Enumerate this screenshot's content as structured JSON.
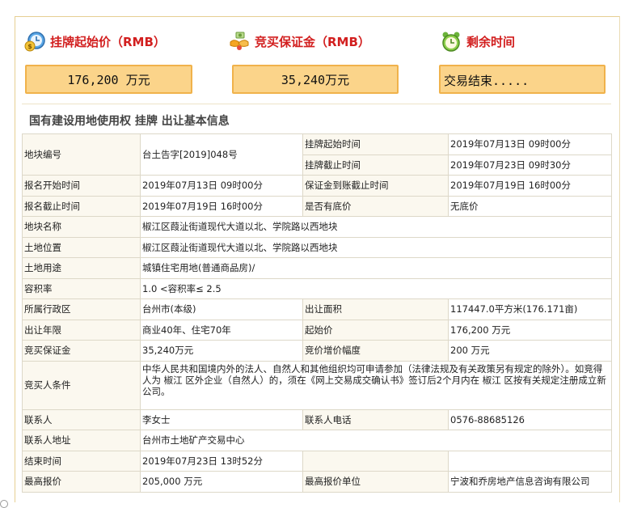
{
  "stats": {
    "start_price": {
      "label": "挂牌起始价（RMB）",
      "value": "176,200  万元",
      "icon": "money-clock-icon"
    },
    "deposit": {
      "label": "竞买保证金（RMB）",
      "value": "35,240万元",
      "icon": "hands-money-icon"
    },
    "remaining": {
      "label": "剩余时间",
      "value": "交易结束.....",
      "icon": "alarm-clock-icon"
    }
  },
  "section_title": "国有建设用地使用权 挂牌 出让基本信息",
  "table": {
    "r1": {
      "l1": "地块编号",
      "v1": "台土告字[2019]048号",
      "l2a": "挂牌起始时间",
      "v2a": "2019年07月13日 09时00分",
      "l2b": "挂牌截止时间",
      "v2b": "2019年07月23日 09时30分"
    },
    "r2": {
      "l1": "报名开始时间",
      "v1": "2019年07月13日 09时00分",
      "l2": "保证金到账截止时间",
      "v2": "2019年07月19日 16时00分"
    },
    "r3": {
      "l1": "报名截止时间",
      "v1": "2019年07月19日 16时00分",
      "l2": "是否有底价",
      "v2": "无底价"
    },
    "r4": {
      "l": "地块名称",
      "v": "椒江区葭沚街道现代大道以北、学院路以西地块"
    },
    "r5": {
      "l": "土地位置",
      "v": "椒江区葭沚街道现代大道以北、学院路以西地块"
    },
    "r6": {
      "l": "土地用途",
      "v": "城镇住宅用地(普通商品房)/"
    },
    "r7": {
      "l": "容积率",
      "v": "1.0 <容积率≤ 2.5"
    },
    "r8": {
      "l1": "所属行政区",
      "v1": "台州市(本级)",
      "l2": "出让面积",
      "v2": "117447.0平方米(176.171亩)"
    },
    "r9": {
      "l1": "出让年限",
      "v1": "商业40年、住宅70年",
      "l2": "起始价",
      "v2": "176,200 万元"
    },
    "r10": {
      "l1": "竞买保证金",
      "v1": "35,240万元",
      "l2": "竞价增价幅度",
      "v2": "200 万元"
    },
    "r11": {
      "l": "竞买人条件",
      "v": "中华人民共和国境内外的法人、自然人和其他组织均可申请参加（法律法规及有关政策另有规定的除外）。如竞得人为 椒江 区外企业（自然人）的，须在《网上交易成交确认书》签订后2个月内在 椒江 区按有关规定注册成立新公司。"
    },
    "r12": {
      "l1": "联系人",
      "v1": "李女士",
      "l2": "联系人电话",
      "v2": "0576-88685126"
    },
    "r13": {
      "l": "联系人地址",
      "v": "台州市土地矿产交易中心"
    },
    "r14": {
      "l1": "结束时间",
      "v1": "2019年07月23日 13时52分",
      "l2": "",
      "v2": ""
    },
    "r15": {
      "l1": "最高报价",
      "v1": "205,000 万元",
      "l2": "最高报价单位",
      "v2": "宁波和乔房地产信息咨询有限公司"
    }
  }
}
